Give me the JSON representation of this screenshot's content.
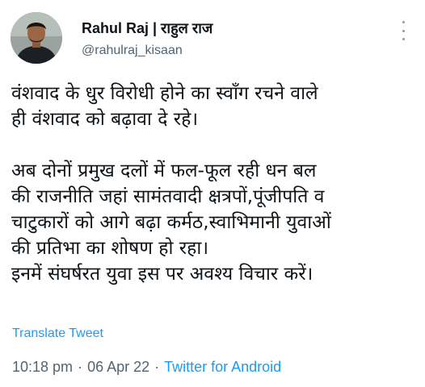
{
  "author": {
    "display_name": "Rahul Raj | राहुल राज",
    "handle": "@rahulraj_kisaan"
  },
  "tweet": {
    "lines": [
      "वंशवाद के धुर विरोधी होने का स्वाँग रचने वाले",
      "ही वंशवाद को बढ़ावा दे रहे।",
      "",
      "अब दोनों प्रमुख दलों में फल-फूल रही धन बल",
      "की राजनीति जहां सामंतवादी क्षत्रपों,पूंजीपति व",
      "चाटुकारों को आगे बढ़ा कर्मठ,स्वाभिमानी युवाओं",
      "की प्रतिभा का शोषण हो रहा।",
      "इनमें संघर्षरत युवा इस पर अवश्य विचार करें।"
    ],
    "translate_label": "Translate Tweet"
  },
  "meta": {
    "time": "10:18 pm",
    "date": "06 Apr 22",
    "source": "Twitter for Android",
    "separator": "·"
  },
  "icons": {
    "more": "more-vertical-icon"
  },
  "colors": {
    "link": "#1d9bf0",
    "secondary_text": "#536471",
    "primary_text": "#0f1419"
  }
}
